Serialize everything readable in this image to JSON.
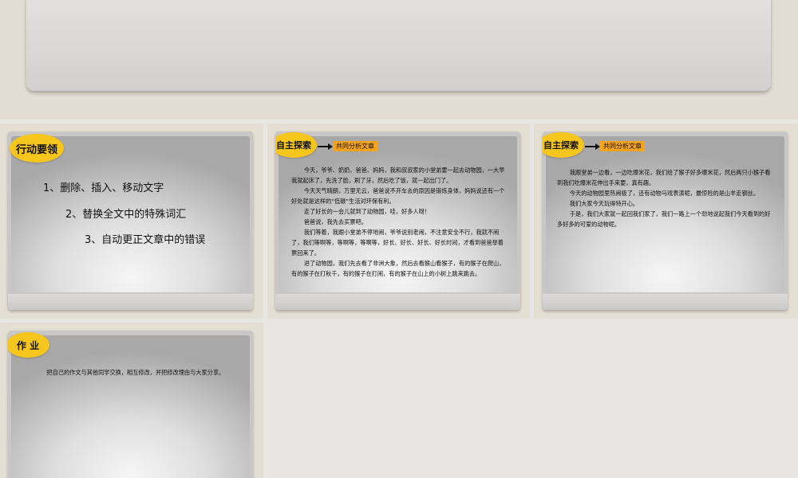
{
  "slide_action": {
    "title": "行动要领",
    "items": [
      "1、删除、插入、移动文字",
      "2、替换全文中的特殊词汇",
      "3、自动更正文章中的错误"
    ]
  },
  "slide_explore_1": {
    "title": "自主探索",
    "tag": "共同分析文章",
    "paragraphs": [
      "今天，爷爷、奶奶、爸爸、妈妈，我和叔叔家的小堂弟要一起去动物园，一大早我就起床了，先洗了脸，刷了牙，然后吃了饭，就一起出门了。",
      "今天天气晴朗，万里无云，爸爸说不开车去的原因是锻炼身体，妈妈说还有一个好处就是这样的“低碳”生活对环保有利。",
      "走了好长的一会儿就到了动物园，哇，好多人呀！",
      "爸爸说，我先去买票吧。",
      "我们等着，我跟小堂弟不停地闹，爷爷说别老闹，不注意安全不行，我就不闹了，我们等啊等，等啊等，等啊等，好长、好长、好长、好长时间，才看到爸爸举着票回来了。",
      "进了动物园，我们先去看了非洲大象，然后去看猴山看猴子，有的猴子在爬山，有的猴子在打秋千，有的猴子在打闹，有的猴子在山上的小树上跳来跳去。"
    ]
  },
  "slide_explore_2": {
    "title": "自主探索",
    "tag": "共同分析文章",
    "paragraphs": [
      "我跟堂弟一边看，一边吃爆米花，我们给了猴子好多爆米花，然后两只小猴子看到我们吃爆米花伸出手来要，真有趣。",
      "今天的动物园里热闹极了，还有动物马戏表演呢，最惊险的是山羊走钢丝。",
      "我们大家今天玩得特开心。",
      "于是，我们大家就一起回我们家了，我们一路上一个劲地说起我们今天看到的好多好多的可爱的动物呢。"
    ]
  },
  "slide_homework": {
    "title": "作 业",
    "text": "把自己的作文与其他同学交换，相互修改，并把修改理由与大家分享。"
  },
  "colors": {
    "pill": "#f7c61c",
    "tag": "#f7a31c"
  }
}
